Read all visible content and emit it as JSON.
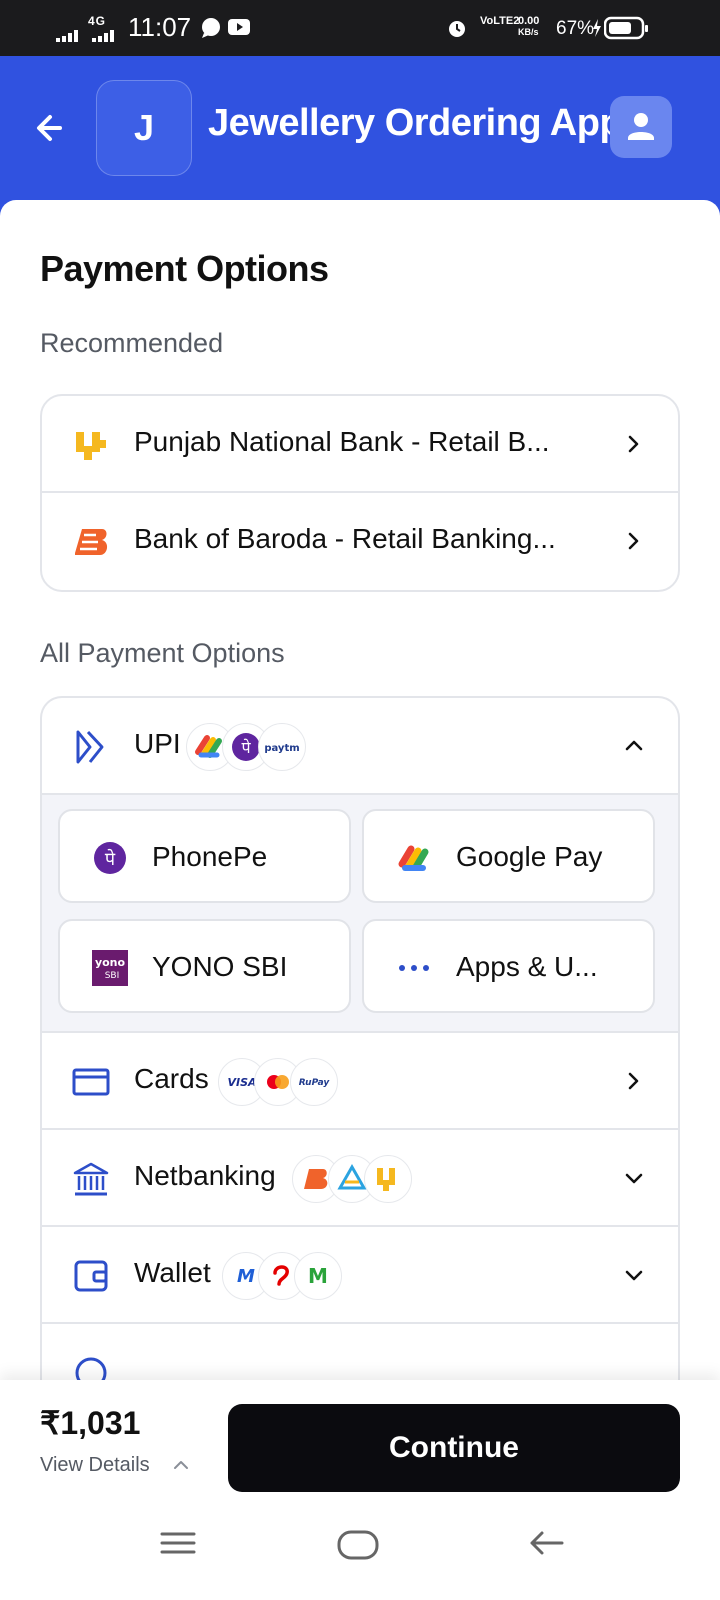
{
  "status_bar": {
    "network": "4G",
    "time": "11:07",
    "lte_label": "VoLTE2",
    "speed_value": "0.00",
    "speed_unit": "KB/s",
    "battery_percent": "67%"
  },
  "header": {
    "logo_letter": "J",
    "title": "Jewellery Ordering App"
  },
  "page": {
    "title": "Payment Options",
    "recommended_label": "Recommended",
    "all_options_label": "All Payment Options"
  },
  "recommended": [
    {
      "label": "Punjab National Bank - Retail B...",
      "icon": "pnb-logo-icon"
    },
    {
      "label": "Bank of Baroda - Retail Banking...",
      "icon": "bob-logo-icon"
    }
  ],
  "all_options": {
    "upi": {
      "label": "UPI",
      "chips": [
        "google-pay-icon",
        "phonepe-icon",
        "paytm-icon"
      ],
      "apps": [
        {
          "label": "PhonePe",
          "icon": "phonepe-icon"
        },
        {
          "label": "Google Pay",
          "icon": "google-pay-icon"
        },
        {
          "label": "YONO SBI",
          "icon": "yono-sbi-icon"
        },
        {
          "label": "Apps & U...",
          "icon": "more-dots-icon"
        }
      ]
    },
    "cards": {
      "label": "Cards",
      "chips": [
        "visa-icon",
        "mastercard-icon",
        "rupay-icon"
      ]
    },
    "netbanking": {
      "label": "Netbanking",
      "chips": [
        "bob-logo-icon",
        "bank-logo-icon",
        "pnb-logo-icon"
      ]
    },
    "wallet": {
      "label": "Wallet",
      "chips": [
        "mobikwik-icon",
        "airtel-payments-bank-icon",
        "m-wallet-icon"
      ]
    }
  },
  "footer": {
    "amount": "₹1,031",
    "view_details": "View Details",
    "continue_label": "Continue"
  },
  "colors": {
    "brand": "#3052e0",
    "button": "#0b0b0f"
  }
}
